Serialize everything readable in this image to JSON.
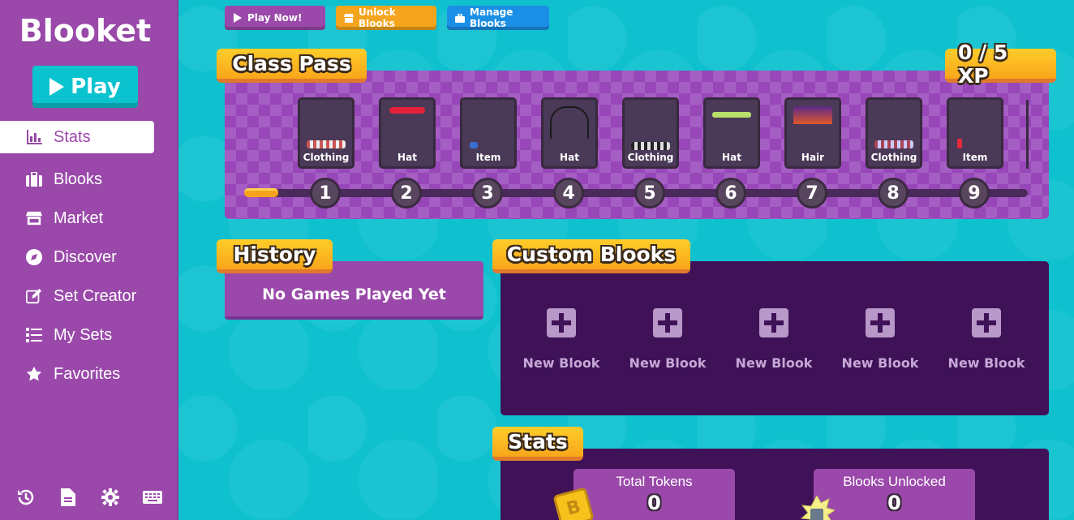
{
  "sidebar": {
    "logo": "Blooket",
    "play_label": "Play",
    "items": [
      {
        "label": "Stats",
        "icon": "chart-icon",
        "active": true
      },
      {
        "label": "Blooks",
        "icon": "briefcase-icon"
      },
      {
        "label": "Market",
        "icon": "store-icon"
      },
      {
        "label": "Discover",
        "icon": "compass-icon"
      },
      {
        "label": "Set Creator",
        "icon": "edit-icon"
      },
      {
        "label": "My Sets",
        "icon": "list-icon"
      },
      {
        "label": "Favorites",
        "icon": "star-icon"
      }
    ],
    "bottom_icons": [
      "history-icon",
      "document-icon",
      "gear-icon",
      "keyboard-icon"
    ]
  },
  "top_buttons": {
    "play_now": "Play Now!",
    "unlock_blooks": "Unlock Blooks",
    "manage_blooks": "Manage Blooks"
  },
  "class_pass": {
    "title": "Class Pass",
    "xp": "0 / 5 XP",
    "rewards": [
      {
        "level": "1",
        "label": "Clothing"
      },
      {
        "level": "2",
        "label": "Hat"
      },
      {
        "level": "3",
        "label": "Item"
      },
      {
        "level": "4",
        "label": "Hat"
      },
      {
        "level": "5",
        "label": "Clothing"
      },
      {
        "level": "6",
        "label": "Hat"
      },
      {
        "level": "7",
        "label": "Hair"
      },
      {
        "level": "8",
        "label": "Clothing"
      },
      {
        "level": "9",
        "label": "Item"
      }
    ]
  },
  "history": {
    "title": "History",
    "empty_text": "No Games Played Yet"
  },
  "custom_blooks": {
    "title": "Custom Blooks",
    "items": [
      "New Blook",
      "New Blook",
      "New Blook",
      "New Blook",
      "New Blook"
    ]
  },
  "stats": {
    "title": "Stats",
    "cards": [
      {
        "title": "Total Tokens",
        "value": "0"
      },
      {
        "title": "Blooks Unlocked",
        "value": "0"
      }
    ]
  },
  "colors": {
    "background": "#0bc2cf",
    "sidebar": "#9a49aa",
    "panel_dark": "#3f1258",
    "header_yellow": "#ffcd2a"
  }
}
